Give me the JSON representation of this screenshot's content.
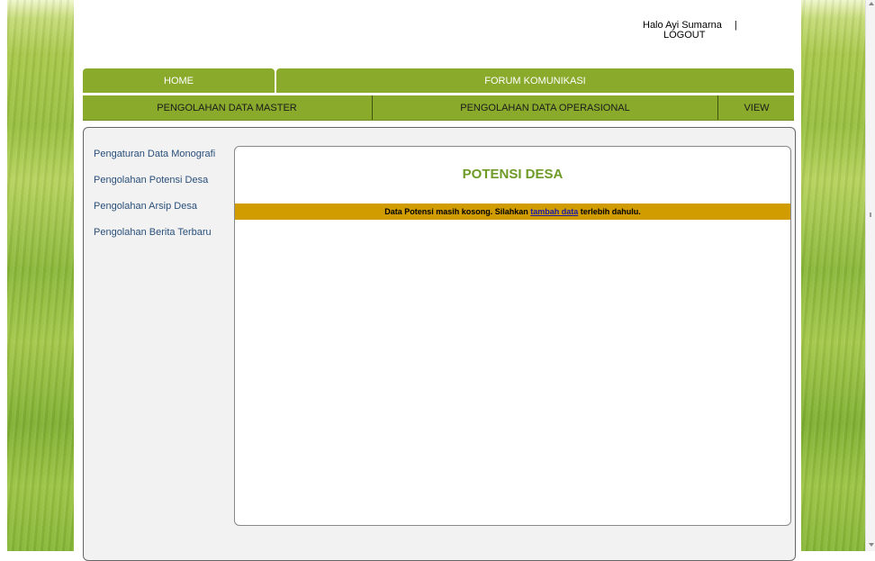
{
  "header": {
    "greeting": "Halo Ayi Sumarna",
    "separator": "|",
    "logout": "LOGOUT"
  },
  "nav_primary": {
    "home": "HOME",
    "forum": "FORUM KOMUNIKASI"
  },
  "nav_secondary": {
    "master": "PENGOLAHAN DATA MASTER",
    "operasional": "PENGOLAHAN DATA OPERASIONAL",
    "view": "VIEW"
  },
  "sidebar": {
    "items": [
      {
        "label": "Pengaturan Data Monografi"
      },
      {
        "label": "Pengolahan Potensi Desa"
      },
      {
        "label": "Pengolahan Arsip Desa"
      },
      {
        "label": "Pengolahan Berita Terbaru"
      }
    ]
  },
  "main": {
    "title": "POTENSI DESA",
    "notice_before": "Data Potensi masih kosong. Silahkan ",
    "notice_link": "tambah data",
    "notice_after": " terlebih dahulu."
  },
  "colors": {
    "nav_green": "#8aaa2c",
    "title_green": "#6e9a26",
    "notice_bg": "#d19c00",
    "sidebar_link": "#2a4f7a"
  }
}
